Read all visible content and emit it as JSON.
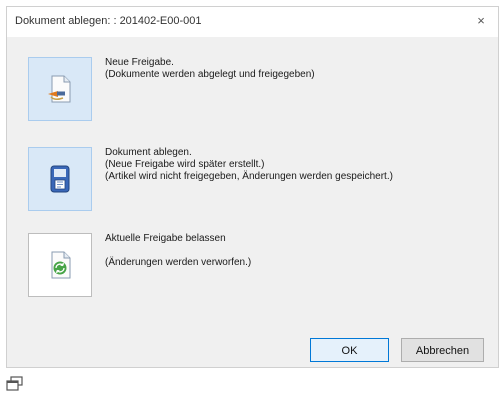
{
  "dialog": {
    "title": "Dokument ablegen: : 201402-E00-001",
    "close_glyph": "×"
  },
  "options": [
    {
      "icon": "release-document-icon",
      "lines": [
        "Neue Freigabe.",
        "(Dokumente werden abgelegt und freigegeben)"
      ]
    },
    {
      "icon": "save-document-icon",
      "lines": [
        "Dokument ablegen.",
        "(Neue Freigabe wird später erstellt.)",
        "(Artikel wird nicht freigegeben, Änderungen werden gespeichert.)"
      ]
    },
    {
      "icon": "keep-release-icon",
      "lines": [
        "Aktuelle Freigabe belassen",
        "",
        "(Änderungen werden verworfen.)"
      ]
    }
  ],
  "buttons": {
    "ok_label": "OK",
    "cancel_label": "Abbrechen"
  },
  "colors": {
    "accent": "#0078d7",
    "option_highlight": "#d9e8f7"
  }
}
